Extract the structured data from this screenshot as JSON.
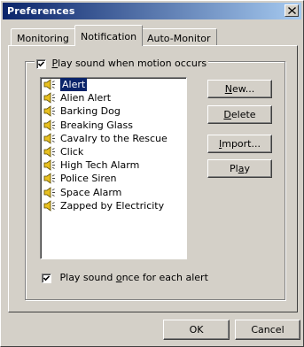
{
  "window": {
    "title": "Preferences",
    "close_glyph": "✕"
  },
  "tabs": [
    {
      "label": "Monitoring",
      "active": false
    },
    {
      "label": "Notification",
      "active": true
    },
    {
      "label": "Auto-Monitor",
      "active": false
    }
  ],
  "sound_group": {
    "play_sound_checked": true,
    "play_sound_prefix": "",
    "play_sound_hotkey": "P",
    "play_sound_rest": "lay sound when motion occurs"
  },
  "sounds": {
    "selected": "Alert",
    "items": [
      "Alert",
      "Alien Alert",
      "Barking Dog",
      "Breaking Glass",
      "Cavalry to the Rescue",
      "Click",
      "High Tech Alarm",
      "Police Siren",
      "Space Alarm",
      "Zapped by Electricity"
    ],
    "item_icon": "speaker-icon"
  },
  "side_buttons": {
    "new": {
      "hotkey": "N",
      "rest": "ew..."
    },
    "delete": {
      "hotkey": "D",
      "rest": "elete"
    },
    "import": {
      "hotkey": "I",
      "rest": "mport..."
    },
    "play": {
      "prefix": "Pl",
      "hotkey": "a",
      "rest": "y"
    }
  },
  "play_once": {
    "checked": true,
    "prefix": "Play sound ",
    "hotkey": "o",
    "rest": "nce for each alert"
  },
  "footer": {
    "ok_label": "OK",
    "cancel_label": "Cancel"
  },
  "colors": {
    "dialog_face": "#d4d0c8",
    "title_start": "#0a246a",
    "title_end": "#a6caf0",
    "selection": "#0a246a"
  }
}
